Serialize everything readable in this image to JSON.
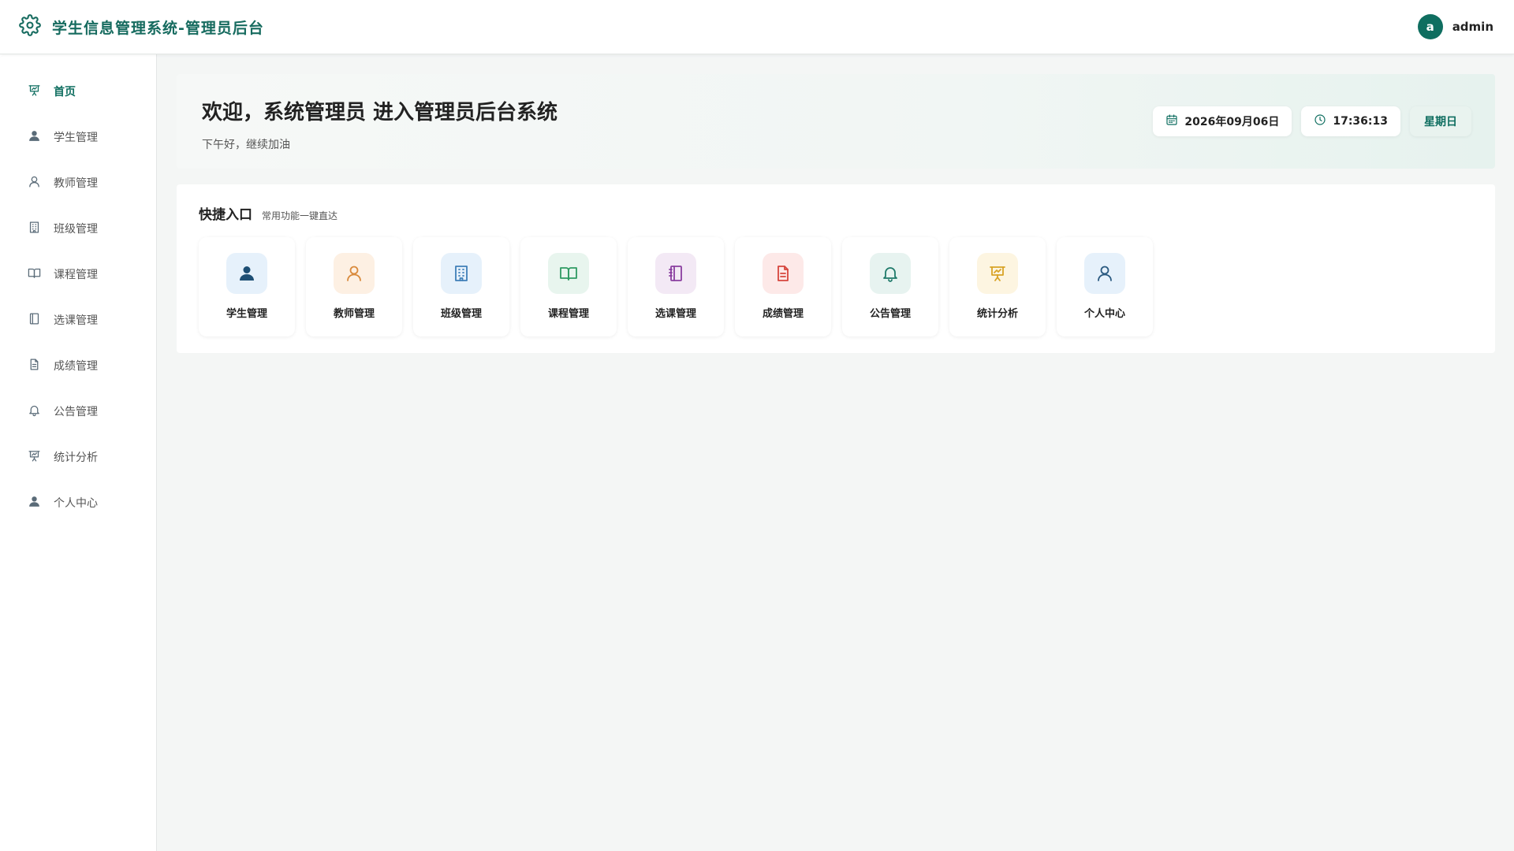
{
  "header": {
    "title": "学生信息管理系统-管理员后台",
    "icon": "gear-icon",
    "user": {
      "avatar_letter": "a",
      "name": "admin"
    }
  },
  "sidebar": {
    "items": [
      {
        "label": "首页",
        "icon": "presentation-chart-icon",
        "active": true
      },
      {
        "label": "学生管理",
        "icon": "user-filled-icon"
      },
      {
        "label": "教师管理",
        "icon": "user-outline-icon"
      },
      {
        "label": "班级管理",
        "icon": "building-icon"
      },
      {
        "label": "课程管理",
        "icon": "book-open-icon"
      },
      {
        "label": "选课管理",
        "icon": "notebook-icon"
      },
      {
        "label": "成绩管理",
        "icon": "document-icon"
      },
      {
        "label": "公告管理",
        "icon": "bell-icon"
      },
      {
        "label": "统计分析",
        "icon": "presentation-chart-icon"
      },
      {
        "label": "个人中心",
        "icon": "user-filled-icon"
      }
    ]
  },
  "welcome": {
    "title": "欢迎，系统管理员 进入管理员后台系统",
    "subtitle": "下午好，继续加油",
    "date": "2026年09月06日",
    "time": "17:36:13",
    "weekday": "星期日"
  },
  "quick": {
    "title": "快捷入口",
    "subtitle": "常用功能一键直达",
    "cards": [
      {
        "label": "学生管理",
        "icon": "user-filled-icon",
        "bg": "#e6f1fb",
        "color": "#1d4e74"
      },
      {
        "label": "教师管理",
        "icon": "user-outline-icon",
        "bg": "#fdf0e3",
        "color": "#d98a3c"
      },
      {
        "label": "班级管理",
        "icon": "building-icon",
        "bg": "#e6f1fb",
        "color": "#3f7fb8"
      },
      {
        "label": "课程管理",
        "icon": "book-open-icon",
        "bg": "#e8f5ee",
        "color": "#2f9a63"
      },
      {
        "label": "选课管理",
        "icon": "notebook-icon",
        "bg": "#f3e9f5",
        "color": "#8a3ea0"
      },
      {
        "label": "成绩管理",
        "icon": "document-icon",
        "bg": "#fde9e8",
        "color": "#d6453c"
      },
      {
        "label": "公告管理",
        "icon": "bell-icon",
        "bg": "#e7f3f0",
        "color": "#1f7a6a"
      },
      {
        "label": "统计分析",
        "icon": "presentation-chart-icon",
        "bg": "#fdf5e1",
        "color": "#d8a326"
      },
      {
        "label": "个人中心",
        "icon": "user-outline-icon",
        "bg": "#e6f1fb",
        "color": "#2b5a80"
      }
    ]
  },
  "colors": {
    "accent": "#0f6e60",
    "brand_text": "#166b5f",
    "sidebar_icon": "#5a6b78"
  }
}
